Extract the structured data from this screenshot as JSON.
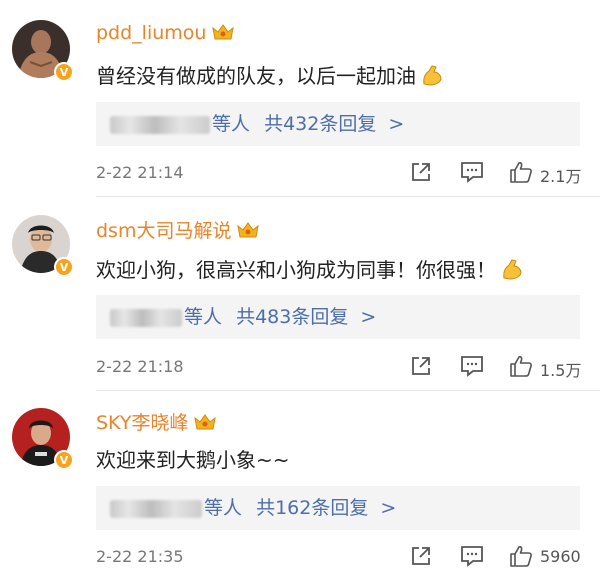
{
  "comments": [
    {
      "username": "pdd_liumou",
      "text": "曾经没有做成的队友，以后一起加油",
      "reply_suffix": "等人",
      "reply_count": "共432条回复",
      "reply_arrow": ">",
      "time": "2-22 21:14",
      "likes": "2.1万"
    },
    {
      "username": "dsm大司马解说",
      "text": "欢迎小狗，很高兴和小狗成为同事！你很强！",
      "reply_suffix": "等人",
      "reply_count": "共483条回复",
      "reply_arrow": ">",
      "time": "2-22 21:18",
      "likes": "1.5万"
    },
    {
      "username": "SKY李晓峰",
      "text": "欢迎来到大鹅小象~~",
      "reply_suffix": "等人",
      "reply_count": "共162条回复",
      "reply_arrow": ">",
      "time": "2-22 21:35",
      "likes": "5960"
    }
  ],
  "colors": {
    "username": "#e8852a",
    "reply_link": "#4d6ea8",
    "badge": "#f7a31c"
  },
  "icons": [
    "crown-icon",
    "verified-badge-icon",
    "flexed-biceps-icon",
    "share-icon",
    "comment-icon",
    "like-icon"
  ]
}
